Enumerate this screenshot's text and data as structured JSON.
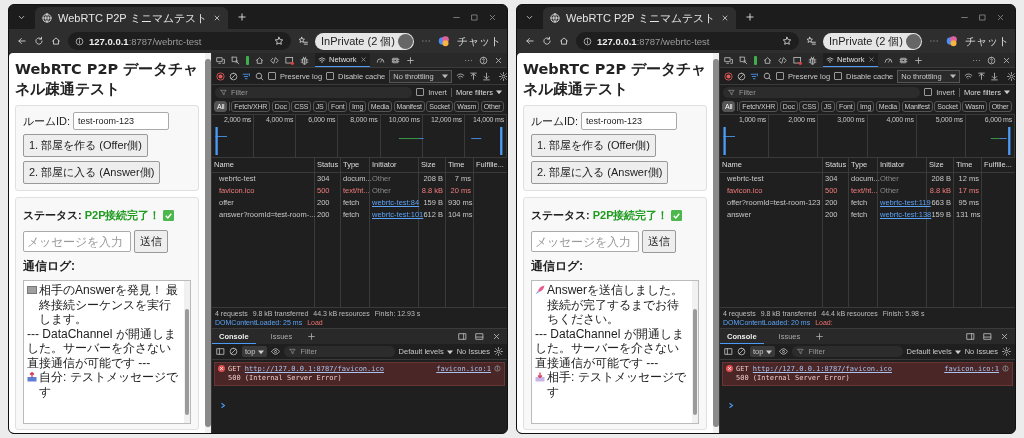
{
  "windows": [
    {
      "tab_title": "WebRTC P2P ミニマムテスト",
      "url_host": "127.0.0.1",
      "url_path": ":8787/webrtc-test",
      "profile": "InPrivate (2 個)",
      "chat": "チャット",
      "page": {
        "heading": "WebRTC P2P データチャネル疎通テスト",
        "room_label": "ルームID:",
        "room_value": "test-room-123",
        "buttons": [
          "1. 部屋を作る (Offer側)",
          "2. 部屋に入る (Answer側)"
        ],
        "status_label": "ステータス:",
        "status_value": "P2P接続完了！",
        "status_ok": true,
        "message_placeholder": "メッセージを入力",
        "send": "送信",
        "log_label": "通信ログ:",
        "log": [
          {
            "kind": "missing",
            "text": "相手のAnswerを発見！ 最終接続シーケンスを実行します。"
          },
          {
            "kind": "plain",
            "text": "--- DataChannel が開通しました。サーバーを介さない直接通信が可能です ---"
          },
          {
            "kind": "outbox",
            "text": "自分: テストメッセージです"
          }
        ]
      },
      "devtools": {
        "panel_tab": "Network",
        "preserve_log": {
          "label": "Preserve log",
          "checked": false
        },
        "disable_cache": {
          "label": "Disable cache",
          "checked": false
        },
        "throttling": "No throttling",
        "filter_placeholder": "Filter",
        "invert": {
          "label": "Invert",
          "checked": false
        },
        "more_filters": "More filters",
        "type_filters": [
          {
            "label": "All",
            "selected": true
          },
          {
            "label": "Fetch/XHR",
            "selected": false
          },
          {
            "label": "Doc",
            "selected": false
          },
          {
            "label": "CSS",
            "selected": false
          },
          {
            "label": "JS",
            "selected": false
          },
          {
            "label": "Font",
            "selected": false
          },
          {
            "label": "Img",
            "selected": false
          },
          {
            "label": "Media",
            "selected": false
          },
          {
            "label": "Manifest",
            "selected": false
          },
          {
            "label": "Socket",
            "selected": false
          },
          {
            "label": "Wasm",
            "selected": false
          },
          {
            "label": "Other",
            "selected": false
          }
        ],
        "timeline_ticks": [
          "2,000 ms",
          "4,000 ms",
          "6,000 ms",
          "8,000 ms",
          "10,000 ms",
          "12,000 ms",
          "14,000 ms"
        ],
        "columns": [
          "Name",
          "Status",
          "Type",
          "Initiator",
          "Size",
          "Time",
          "Fulfille..."
        ],
        "rows": [
          {
            "name": "webrtc-test",
            "status": "304",
            "type": "docum...",
            "initiator": "Other",
            "initiator_link": false,
            "size": "208 B",
            "time": "7 ms",
            "failed": false
          },
          {
            "name": "favicon.ico",
            "status": "500",
            "type": "text/ht...",
            "initiator": "Other",
            "initiator_link": false,
            "size": "8.8 kB",
            "time": "20 ms",
            "failed": true
          },
          {
            "name": "offer",
            "status": "200",
            "type": "fetch",
            "initiator": "webrtc-test:84",
            "initiator_link": true,
            "size": "159 B",
            "time": "930 ms",
            "failed": false
          },
          {
            "name": "answer?roomId=test-room-...",
            "status": "200",
            "type": "fetch",
            "initiator": "webrtc-test:101",
            "initiator_link": true,
            "size": "612 B",
            "time": "104 ms",
            "failed": false
          }
        ],
        "summary": [
          {
            "kind": "plain",
            "text": "4 requests"
          },
          {
            "kind": "plain",
            "text": "9.8 kB transferred"
          },
          {
            "kind": "plain",
            "text": "44.3 kB resources"
          },
          {
            "kind": "plain",
            "text": "Finish: 12.93 s"
          },
          {
            "kind": "dom",
            "text": "DOMContentLoaded: 25 ms"
          },
          {
            "kind": "load",
            "text": "Load"
          }
        ],
        "drawer_tabs": [
          {
            "label": "Console",
            "selected": true
          },
          {
            "label": "Issues",
            "selected": false
          }
        ],
        "context": "top",
        "console_filter": "Filter",
        "levels": "Default levels",
        "issues": "No Issues",
        "messages": [
          {
            "kind": "error",
            "method": "GET",
            "url": "http://127.0.0.1:8787/favicon.ico",
            "detail": "500 (Internal Server Error)",
            "source": "favicon.ico:1"
          }
        ]
      }
    },
    {
      "tab_title": "WebRTC P2P ミニマムテスト",
      "url_host": "127.0.0.1",
      "url_path": ":8787/webrtc-test",
      "profile": "InPrivate (2 個)",
      "chat": "チャット",
      "page": {
        "heading": "WebRTC P2P データチャネル疎通テスト",
        "room_label": "ルームID:",
        "room_value": "test-room-123",
        "buttons": [
          "1. 部屋を作る (Offer側)",
          "2. 部屋に入る (Answer側)"
        ],
        "status_label": "ステータス:",
        "status_value": "P2P接続完了！",
        "status_ok": true,
        "message_placeholder": "メッセージを入力",
        "send": "送信",
        "log_label": "通信ログ:",
        "log": [
          {
            "kind": "rocket",
            "text": "Answerを送信しました。接続が完了するまでお待ちください。"
          },
          {
            "kind": "plain",
            "text": "--- DataChannel が開通しました。サーバーを介さない直接通信が可能です ---"
          },
          {
            "kind": "inbox",
            "text": "相手: テストメッセージです"
          }
        ]
      },
      "devtools": {
        "panel_tab": "Network",
        "preserve_log": {
          "label": "Preserve log",
          "checked": false
        },
        "disable_cache": {
          "label": "Disable cache",
          "checked": false
        },
        "throttling": "No throttling",
        "filter_placeholder": "Filter",
        "invert": {
          "label": "Invert",
          "checked": false
        },
        "more_filters": "More filters",
        "type_filters": [
          {
            "label": "All",
            "selected": true
          },
          {
            "label": "Fetch/XHR",
            "selected": false
          },
          {
            "label": "Doc",
            "selected": false
          },
          {
            "label": "CSS",
            "selected": false
          },
          {
            "label": "JS",
            "selected": false
          },
          {
            "label": "Font",
            "selected": false
          },
          {
            "label": "Img",
            "selected": false
          },
          {
            "label": "Media",
            "selected": false
          },
          {
            "label": "Manifest",
            "selected": false
          },
          {
            "label": "Socket",
            "selected": false
          },
          {
            "label": "Wasm",
            "selected": false
          },
          {
            "label": "Other",
            "selected": false
          }
        ],
        "timeline_ticks": [
          "1,000 ms",
          "2,000 ms",
          "3,000 ms",
          "4,000 ms",
          "5,000 ms",
          "6,000 ms"
        ],
        "columns": [
          "Name",
          "Status",
          "Type",
          "Initiator",
          "Size",
          "Time",
          "Fulfille..."
        ],
        "rows": [
          {
            "name": "webrtc-test",
            "status": "304",
            "type": "docum...",
            "initiator": "Other",
            "initiator_link": false,
            "size": "208 B",
            "time": "12 ms",
            "failed": false
          },
          {
            "name": "favicon.ico",
            "status": "500",
            "type": "text/ht...",
            "initiator": "Other",
            "initiator_link": false,
            "size": "8.8 kB",
            "time": "17 ms",
            "failed": true
          },
          {
            "name": "offer?roomId=test-room-123",
            "status": "200",
            "type": "fetch",
            "initiator": "webrtc-test:119",
            "initiator_link": true,
            "size": "663 B",
            "time": "95 ms",
            "failed": false
          },
          {
            "name": "answer",
            "status": "200",
            "type": "fetch",
            "initiator": "webrtc-test:138",
            "initiator_link": true,
            "size": "159 B",
            "time": "131 ms",
            "failed": false
          }
        ],
        "summary": [
          {
            "kind": "plain",
            "text": "4 requests"
          },
          {
            "kind": "plain",
            "text": "9.8 kB transferred"
          },
          {
            "kind": "plain",
            "text": "44.4 kB resources"
          },
          {
            "kind": "plain",
            "text": "Finish: 5.98 s"
          },
          {
            "kind": "dom",
            "text": "DOMContentLoaded: 20 ms"
          },
          {
            "kind": "load",
            "text": "Load:"
          }
        ],
        "drawer_tabs": [
          {
            "label": "Console",
            "selected": true
          },
          {
            "label": "Issues",
            "selected": false
          }
        ],
        "context": "top",
        "console_filter": "Filter",
        "levels": "Default levels",
        "issues": "No Issues",
        "messages": [
          {
            "kind": "error",
            "method": "GET",
            "url": "http://127.0.0.1:8787/favicon.ico",
            "detail": "500 (Internal Server Error)",
            "source": "favicon.ico:1"
          }
        ]
      }
    }
  ]
}
